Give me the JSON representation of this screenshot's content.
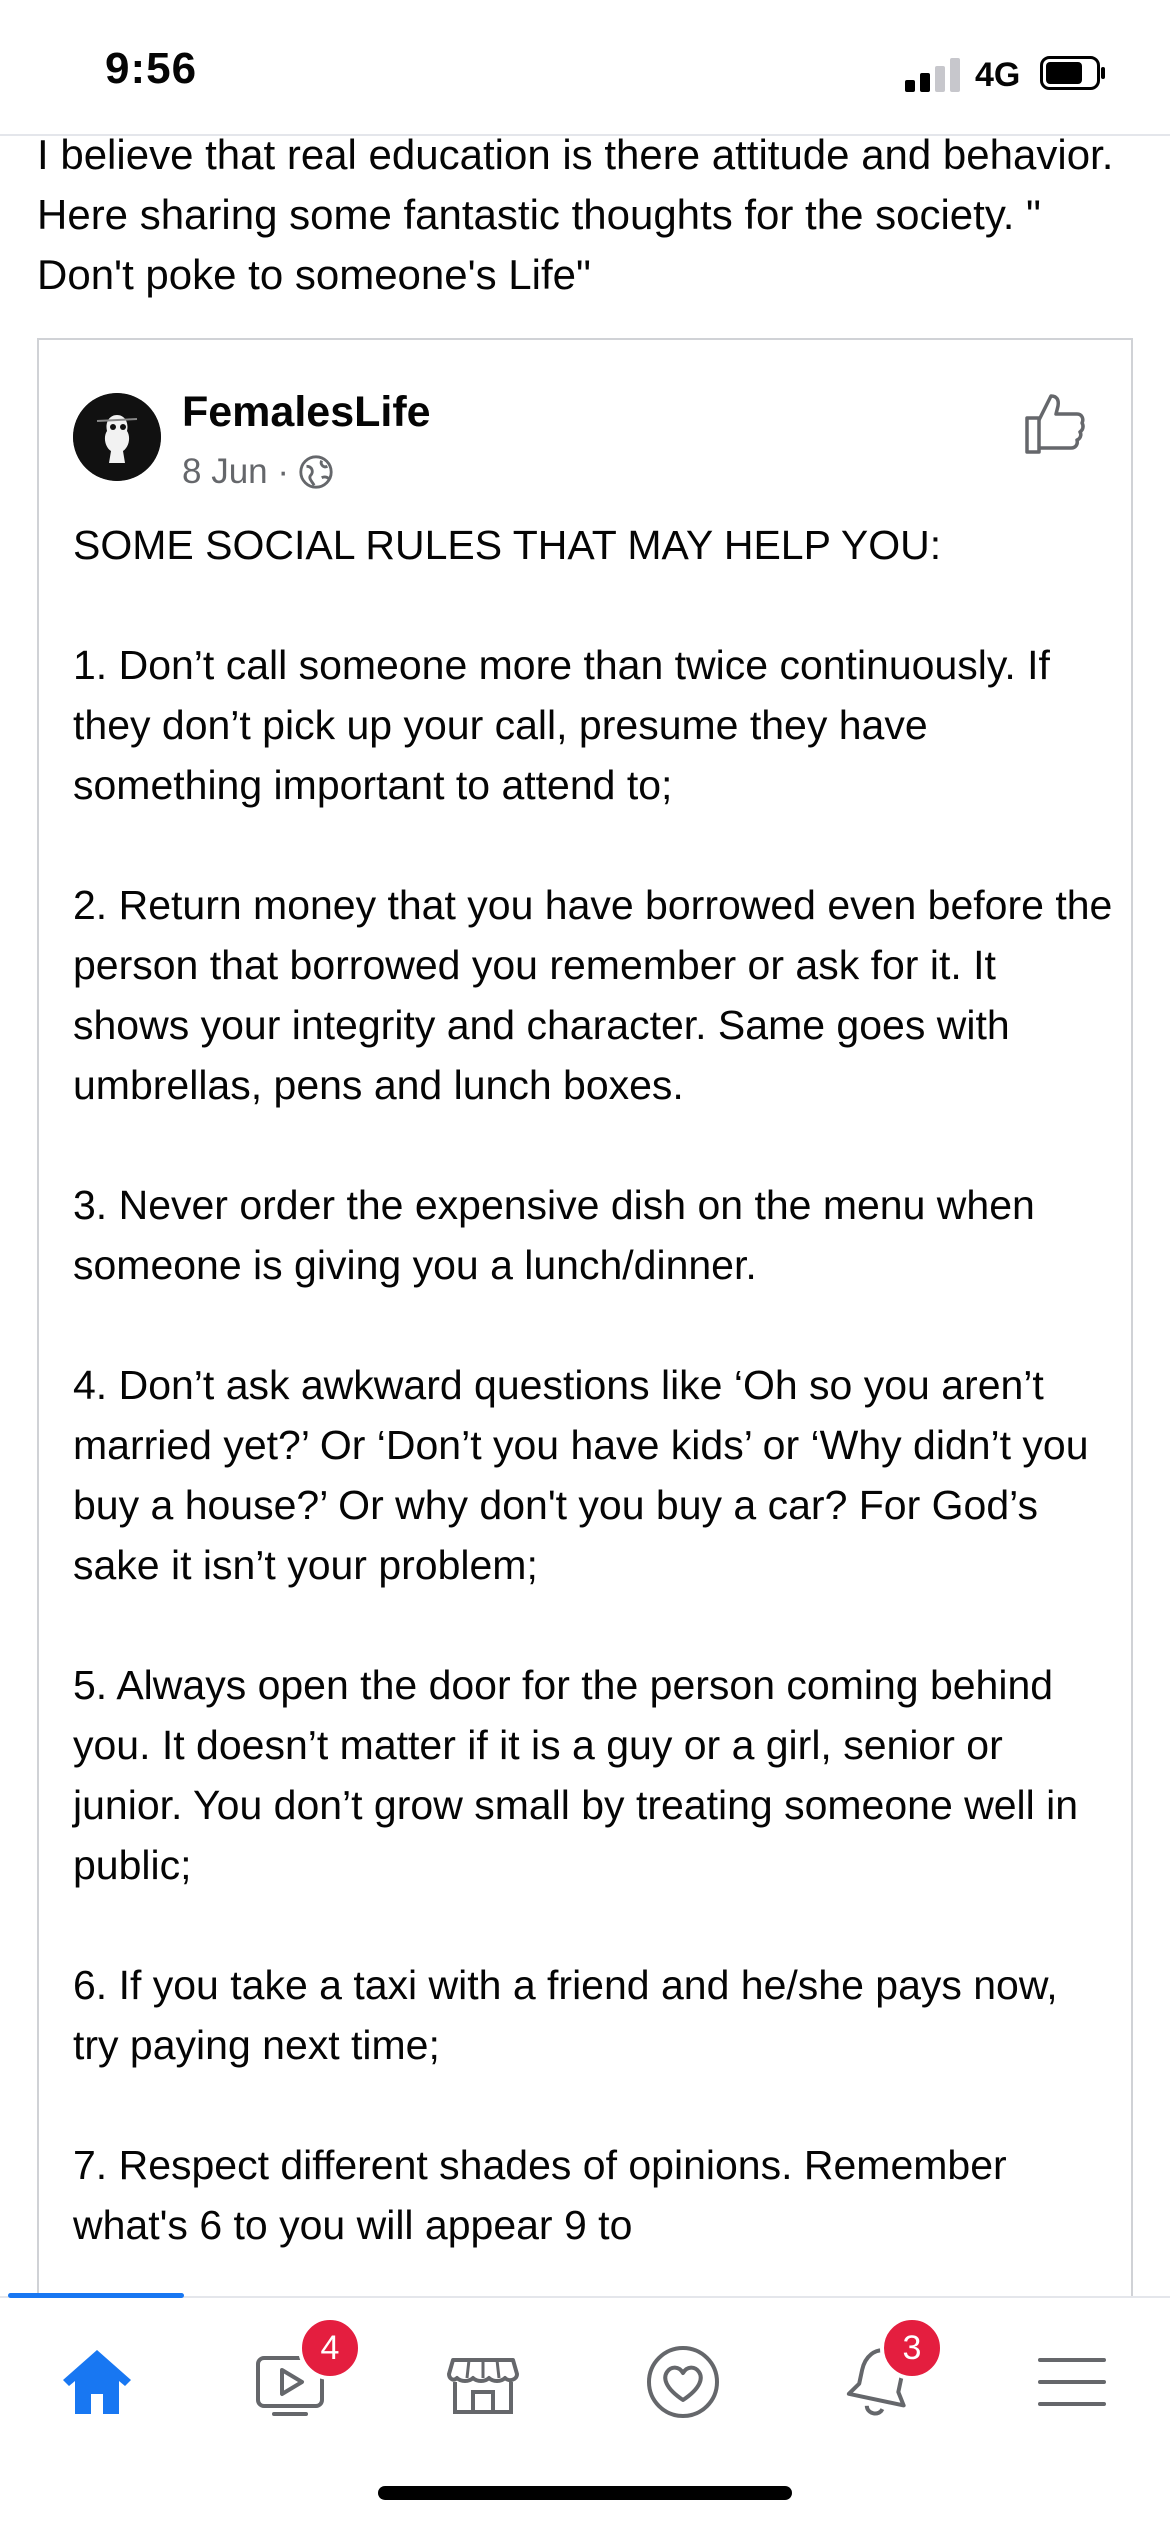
{
  "status_bar": {
    "time": "9:56",
    "network": "4G",
    "battery_level": 0.75
  },
  "intro_text": "I believe that real education is there attitude and behavior. Here sharing some fantastic thoughts for the society. \" Don't poke to someone's Life\"",
  "shared_post": {
    "author": "FemalesLife",
    "date": "8 Jun ·",
    "paragraphs": [
      "SOME SOCIAL RULES THAT MAY HELP YOU:",
      "1. Don’t call someone more than twice continuously. If they don’t pick up your call, presume they have something important to attend to;",
      "2. Return money that you have borrowed even before the person that borrowed you remember or ask for it. It shows your integrity and character. Same goes with umbrellas, pens and lunch boxes.",
      "3. Never order the expensive dish on the menu when someone is giving you a lunch/dinner.",
      "4. Don’t ask awkward questions like ‘Oh so you aren’t married yet?’ Or ‘Don’t you have kids’ or ‘Why didn’t you buy a house?’ Or why don't you buy a car? For God’s sake it isn’t your problem;",
      "5. Always open the door for the person coming behind you. It doesn’t matter if it is a guy or a girl, senior or junior. You don’t grow small by treating someone well in public;",
      "6. If you take a taxi with a friend and he/she pays now, try paying next time;",
      "7. Respect different shades of opinions. Remember what's 6 to you will appear 9 to"
    ]
  },
  "tab_bar": {
    "video_badge": "4",
    "notifications_badge": "3",
    "accent_color": "#1877f2",
    "badge_color": "#e41e3f"
  }
}
